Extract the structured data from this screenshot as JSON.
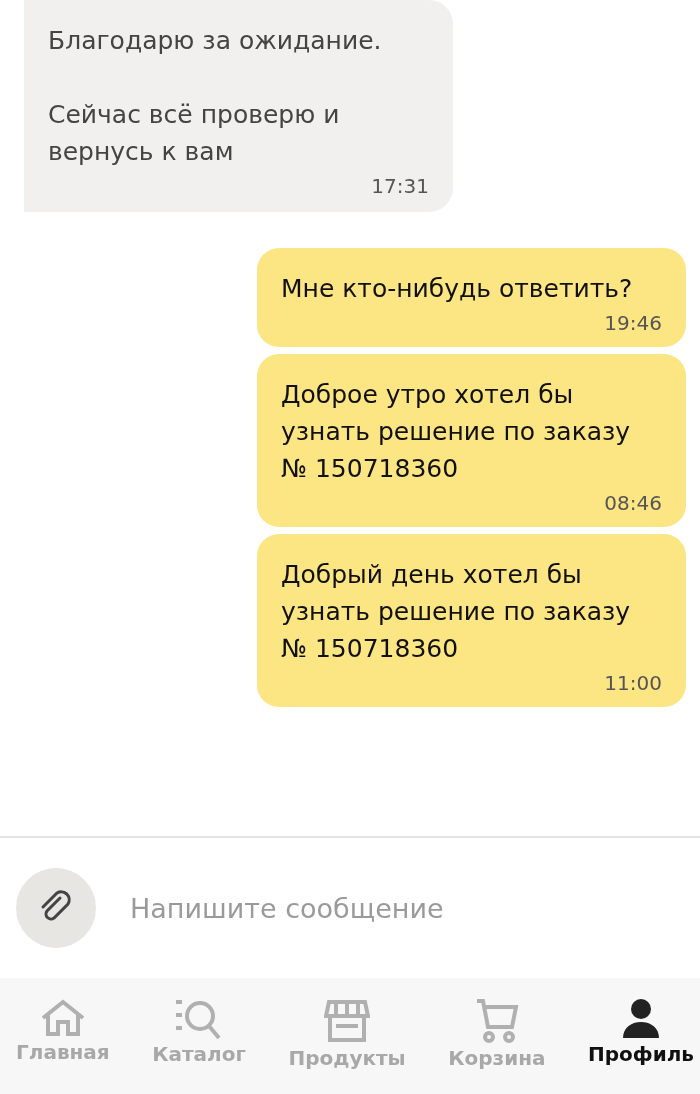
{
  "messages": [
    {
      "kind": "incoming",
      "text": "Благодарю за ожидание.\n\nСейчас всё проверю и\nвернусь к вам",
      "time": "17:31"
    },
    {
      "kind": "outgoing",
      "text": "Мне кто-нибудь ответить?",
      "time": "19:46"
    },
    {
      "kind": "outgoing",
      "text": "Доброе утро хотел бы\nузнать решение по заказу\n№ 150718360",
      "time": "08:46"
    },
    {
      "kind": "outgoing",
      "text": "Добрый день хотел бы\nузнать решение по заказу\n№ 150718360",
      "time": "11:00"
    }
  ],
  "composer": {
    "placeholder": "Напишите сообщение"
  },
  "nav": [
    {
      "kind": "home",
      "label": "Главная",
      "selected": false
    },
    {
      "kind": "catalog",
      "label": "Каталог",
      "selected": false
    },
    {
      "kind": "shop",
      "label": "Продукты",
      "selected": false
    },
    {
      "kind": "cart",
      "label": "Корзина",
      "selected": false
    },
    {
      "kind": "profile",
      "label": "Профиль",
      "selected": true
    }
  ]
}
